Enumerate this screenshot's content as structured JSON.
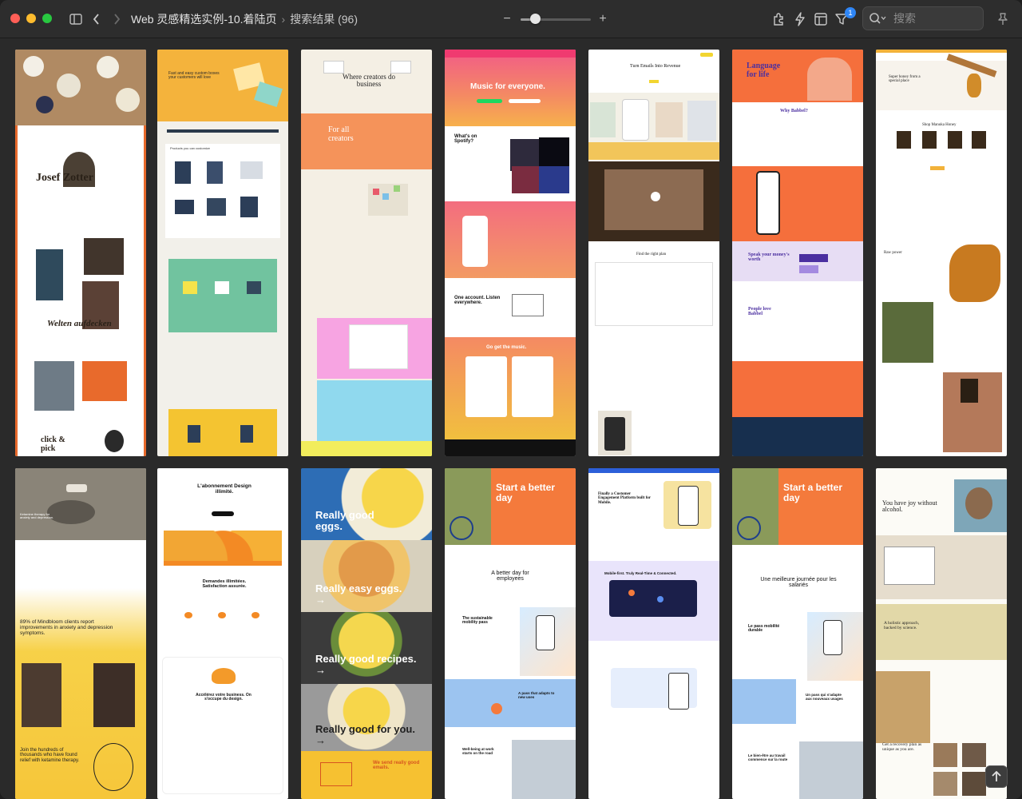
{
  "toolbar": {
    "title": "Web 灵感精选实例-10.着陆页",
    "breadcrumb_sep": "›",
    "breadcrumb": "搜索结果 (96)",
    "zoom_minus": "−",
    "zoom_plus": "+",
    "zoom_level": 0.2,
    "filter_badge": "1",
    "search_placeholder": "搜索"
  },
  "colors": {
    "close": "#ff5f57",
    "minimize": "#febc2e",
    "zoom": "#28c840",
    "accent": "#2f86f6"
  },
  "cards": [
    {
      "name": "zotter",
      "texts": [
        "Josef Zotter",
        "Welten aufdecken",
        "click & pick"
      ]
    },
    {
      "name": "arka",
      "texts": [
        "Fast and easy custom boxes your customers will love",
        "Products you can customize"
      ]
    },
    {
      "name": "creators",
      "texts": [
        "Where creators do business",
        "For all creators"
      ]
    },
    {
      "name": "spotify",
      "texts": [
        "Music for everyone.",
        "What's on Spotify?",
        "One account. Listen everywhere.",
        "Go get the music."
      ]
    },
    {
      "name": "emails",
      "texts": [
        "Turn Emails Into Revenue",
        "Find the right plan"
      ]
    },
    {
      "name": "babbel",
      "texts": [
        "Language for life",
        "Why Babbel?",
        "Speak your money's worth",
        "People love Babbel"
      ]
    },
    {
      "name": "honey",
      "texts": [
        "Super honey from a special place",
        "Shop Manuka Honey",
        "Raw power"
      ]
    },
    {
      "name": "mindbloom",
      "texts": [
        "Ketamine therapy for anxiety and depression.",
        "89% of Mindbloom clients report improvements in anxiety and depression symptoms.",
        "Join the hundreds of thousands who have found relief with ketamine therapy."
      ]
    },
    {
      "name": "design",
      "texts": [
        "L'abonnement Design illimité.",
        "Demandes illimitées. Satisfaction assurée.",
        "Accélérez votre business. On s'occupe du design."
      ]
    },
    {
      "name": "eggs",
      "texts": [
        "Really good eggs.",
        "Really easy eggs. →",
        "Really good recipes. →",
        "Really good for you. →",
        "We send really good emails."
      ]
    },
    {
      "name": "bike-en",
      "texts": [
        "Start a better day",
        "A better day for employees",
        "The sustainable mobility pass",
        "A pass that adapts to new uses",
        "Well-being at work starts on the road"
      ]
    },
    {
      "name": "mobile",
      "texts": [
        "Finally a Customer Engagement Platform built for Mobile.",
        "Mobile-first. Truly Real-Time & Connected."
      ]
    },
    {
      "name": "bike-fr",
      "texts": [
        "Start a better day",
        "Une meilleure journée pour les salariés",
        "Le pass mobilité durable",
        "Un pass qui s'adapte aux nouveaux usages",
        "Le bien-être au travail commence sur la route"
      ]
    },
    {
      "name": "alcohol",
      "texts": [
        "You have joy without alcohol.",
        "A holistic approach, backed by science.",
        "Get a recovery plan as unique as you are."
      ]
    }
  ]
}
